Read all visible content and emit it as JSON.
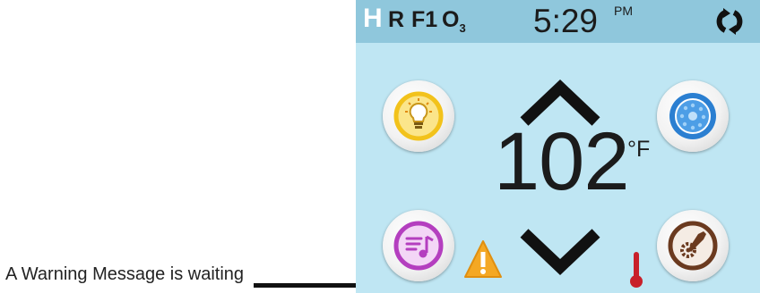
{
  "caption": "A Warning Message is waiting",
  "status_bar": {
    "indicators": {
      "heater": "H",
      "ready": "R",
      "filter": "F",
      "filter_sub": "1",
      "ozone": "O",
      "ozone_sub": "3"
    },
    "time": "5:29",
    "ampm": "PM",
    "sync_icon": "sync-icon"
  },
  "temperature": {
    "value": "102",
    "unit": "°F"
  },
  "buttons": {
    "light": "lightbulb-icon",
    "jets": "jets-icon",
    "music": "music-icon",
    "settings": "settings-icon"
  },
  "icons": {
    "up": "chevron-up-icon",
    "down": "chevron-down-icon",
    "warning": "warning-icon",
    "thermometer": "thermometer-icon"
  },
  "colors": {
    "screen_bg": "#bfe6f3",
    "statusbar_bg": "#8fc7dc",
    "light_accent": "#f2c21b",
    "jets_accent": "#2b7fd1",
    "music_accent": "#b43fbf",
    "settings_accent": "#6b3a1f",
    "warning": "#f4a824",
    "thermometer": "#c8202a"
  }
}
